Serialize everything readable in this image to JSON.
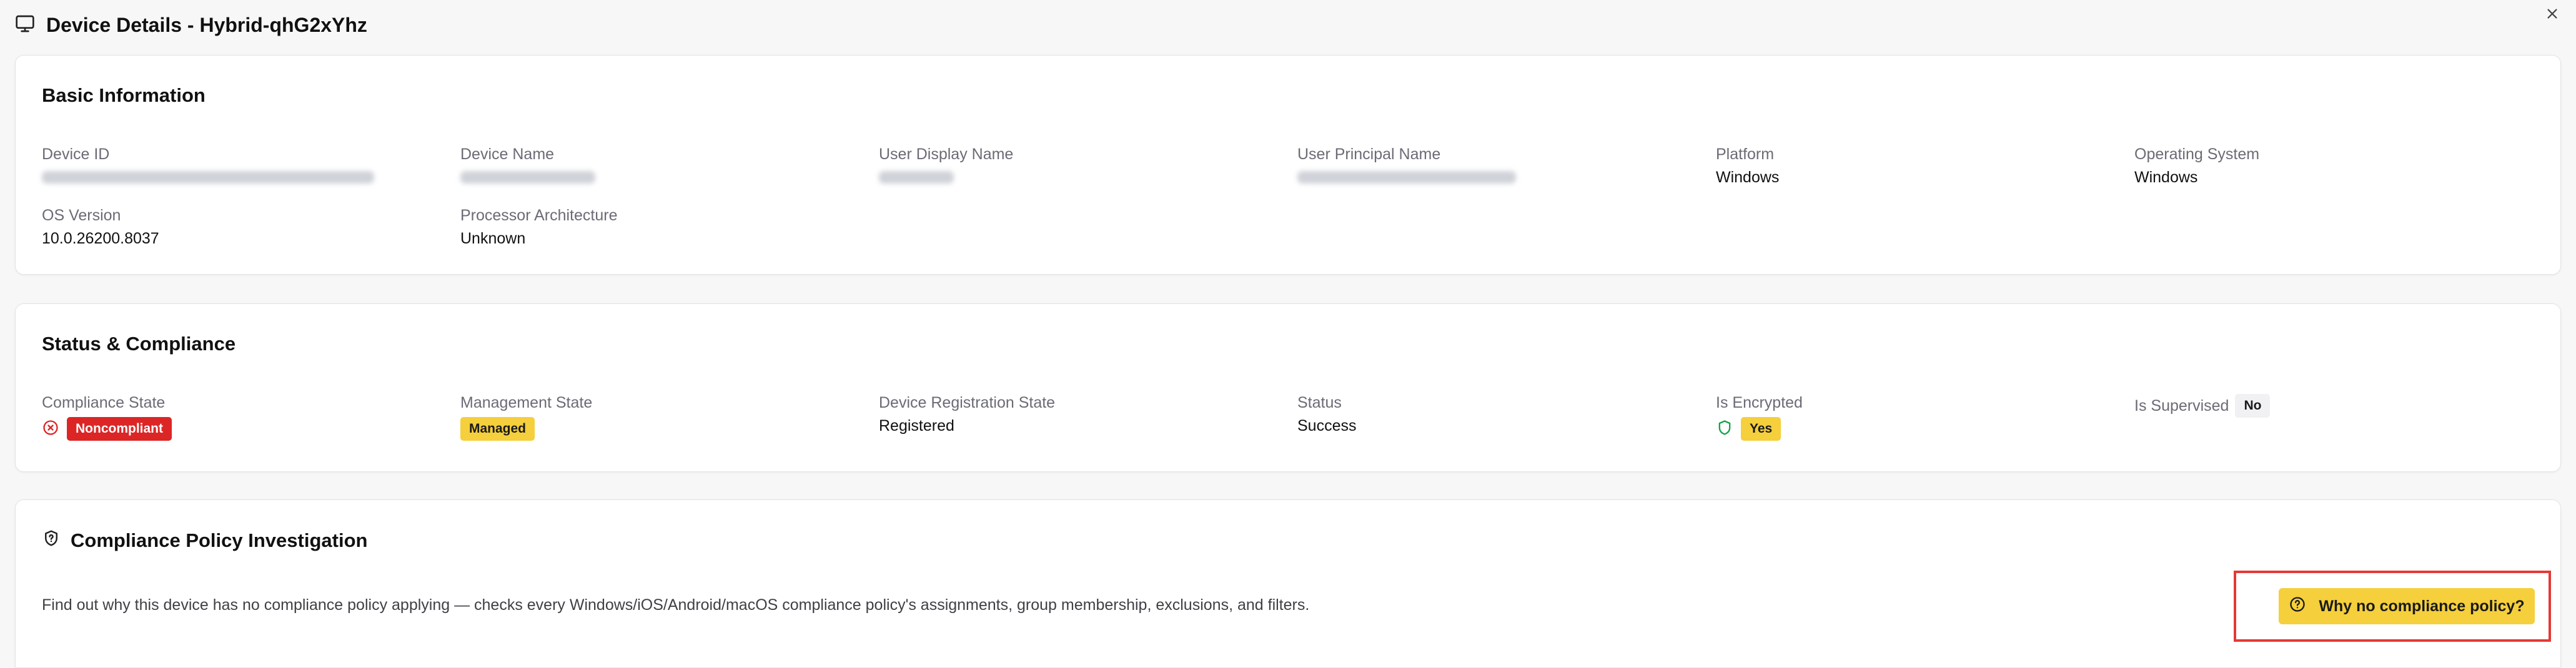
{
  "header": {
    "title": "Device Details - Hybrid-qhG2xYhz",
    "icon": "monitor-icon",
    "close_icon": "close-icon"
  },
  "basic_info": {
    "title": "Basic Information",
    "device_id_label": "Device ID",
    "device_name_label": "Device Name",
    "user_display_name_label": "User Display Name",
    "user_principal_name_label": "User Principal Name",
    "platform_label": "Platform",
    "platform_value": "Windows",
    "os_label": "Operating System",
    "os_value": "Windows",
    "os_version_label": "OS Version",
    "os_version_value": "10.0.26200.8037",
    "processor_label": "Processor Architecture",
    "processor_value": "Unknown"
  },
  "status": {
    "title": "Status & Compliance",
    "compliance_label": "Compliance State",
    "compliance_value": "Noncompliant",
    "management_label": "Management State",
    "management_value": "Managed",
    "registration_label": "Device Registration State",
    "registration_value": "Registered",
    "status_label": "Status",
    "status_value": "Success",
    "encrypted_label": "Is Encrypted",
    "encrypted_value": "Yes",
    "supervised_label": "Is Supervised",
    "supervised_value": "No"
  },
  "policy": {
    "title": "Compliance Policy Investigation",
    "description": "Find out why this device has no compliance policy applying — checks every Windows/iOS/Android/macOS compliance policy's assignments, group membership, exclusions, and filters.",
    "button_label": "Why no compliance policy?"
  },
  "colors": {
    "noncompliant": "#dc2626",
    "badge_yellow": "#f5cf3c",
    "highlight_border": "#e53935",
    "shield_green": "#16a34a"
  }
}
